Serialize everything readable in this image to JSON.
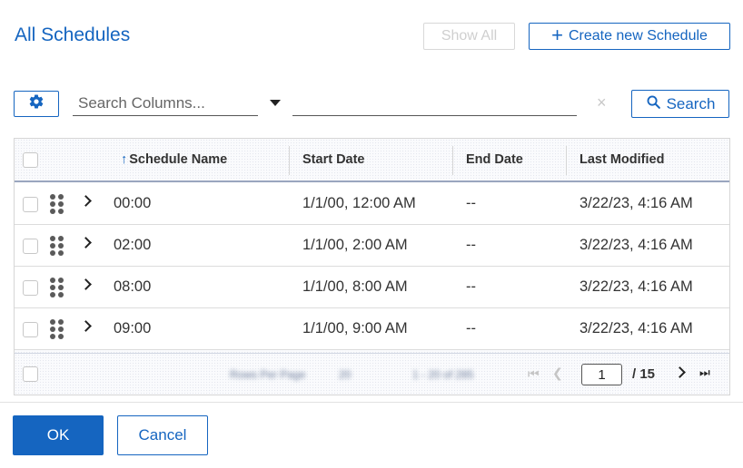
{
  "header": {
    "title": "All Schedules",
    "show_all_label": "Show All",
    "create_label": "Create new Schedule"
  },
  "toolbar": {
    "search_placeholder": "Search Columns...",
    "filter_value": "",
    "clear_symbol": "×",
    "search_label": "Search"
  },
  "table": {
    "columns": [
      "Schedule Name",
      "Start Date",
      "End Date",
      "Last Modified"
    ],
    "sort_indicator": "↑",
    "rows": [
      {
        "name": "00:00",
        "start": "1/1/00, 12:00 AM",
        "end": "--",
        "modified": "3/22/23, 4:16 AM"
      },
      {
        "name": "02:00",
        "start": "1/1/00, 2:00 AM",
        "end": "--",
        "modified": "3/22/23, 4:16 AM"
      },
      {
        "name": "08:00",
        "start": "1/1/00, 8:00 AM",
        "end": "--",
        "modified": "3/22/23, 4:16 AM"
      },
      {
        "name": "09:00",
        "start": "1/1/00, 9:00 AM",
        "end": "--",
        "modified": "3/22/23, 4:16 AM"
      }
    ]
  },
  "pagination": {
    "rows_per_page_label": "Rows Per Page",
    "rows_per_page": "20",
    "range_text": "1 - 20 of 285",
    "current_page": "1",
    "total_pages": "/ 15"
  },
  "footer": {
    "ok_label": "OK",
    "cancel_label": "Cancel"
  },
  "colors": {
    "accent": "#1565c0",
    "header_border": "#9aa6bf"
  }
}
